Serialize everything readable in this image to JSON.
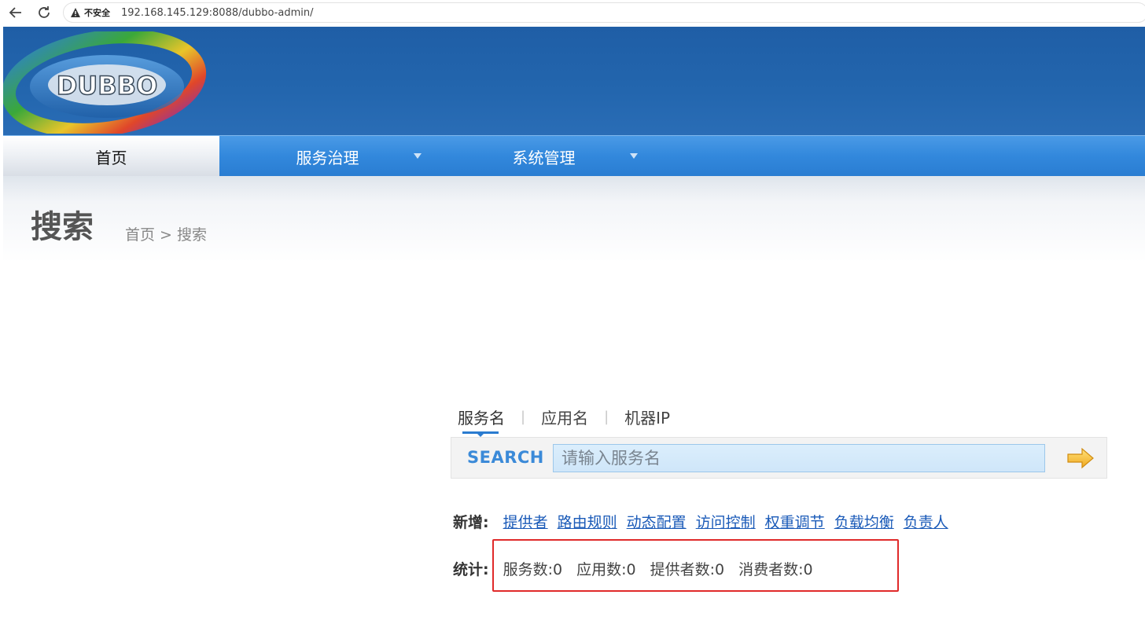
{
  "browser": {
    "insecure_label": "不安全",
    "url": "192.168.145.129:8088/dubbo-admin/"
  },
  "logo": {
    "text": "DUBBO"
  },
  "menu": {
    "items": [
      {
        "label": "首页",
        "active": true
      },
      {
        "label": "服务治理",
        "has_dropdown": true
      },
      {
        "label": "系统管理",
        "has_dropdown": true
      }
    ]
  },
  "page": {
    "title": "搜索",
    "breadcrumb": "首页 > 搜索"
  },
  "search": {
    "tabs": [
      "服务名",
      "应用名",
      "机器IP"
    ],
    "separator": "|",
    "label": "SEARCH",
    "placeholder": "请输入服务名"
  },
  "add": {
    "label": "新增:",
    "links": [
      "提供者",
      "路由规则",
      "动态配置",
      "访问控制",
      "权重调节",
      "负载均衡",
      "负责人"
    ]
  },
  "stats": {
    "label": "统计:",
    "items": [
      "服务数:0",
      "应用数:0",
      "提供者数:0",
      "消费者数:0"
    ]
  },
  "colors": {
    "header_blue": "#2366ae",
    "menu_blue": "#3288dc",
    "link_blue": "#1a5ab8",
    "highlight_red": "#e02a2a"
  }
}
